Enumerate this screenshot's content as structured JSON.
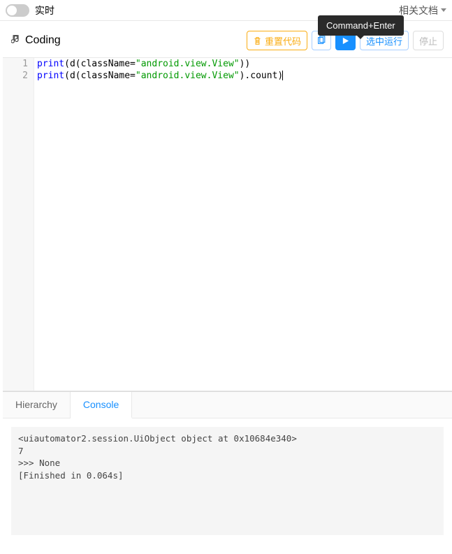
{
  "topbar": {
    "realtime_label": "实时",
    "docs_label": "相关文档"
  },
  "tooltip": {
    "text": "Command+Enter"
  },
  "header": {
    "title": "Coding"
  },
  "toolbar": {
    "reset_label": "重置代码",
    "run_selection_label": "选中运行",
    "stop_label": "停止"
  },
  "editor": {
    "lines": [
      {
        "num": "1",
        "tokens": [
          {
            "t": "kw",
            "v": "print"
          },
          {
            "t": "plain",
            "v": "(d(className="
          },
          {
            "t": "str",
            "v": "\"android.view.View\""
          },
          {
            "t": "plain",
            "v": "))"
          }
        ]
      },
      {
        "num": "2",
        "active": true,
        "tokens": [
          {
            "t": "kw",
            "v": "print"
          },
          {
            "t": "plain",
            "v": "(d(className="
          },
          {
            "t": "str",
            "v": "\"android.view.View\""
          },
          {
            "t": "plain",
            "v": ").count)"
          }
        ]
      }
    ]
  },
  "tabs": {
    "hierarchy": "Hierarchy",
    "console": "Console"
  },
  "console_output": "<uiautomator2.session.UiObject object at 0x10684e340>\n7\n>>> None\n[Finished in 0.064s]"
}
